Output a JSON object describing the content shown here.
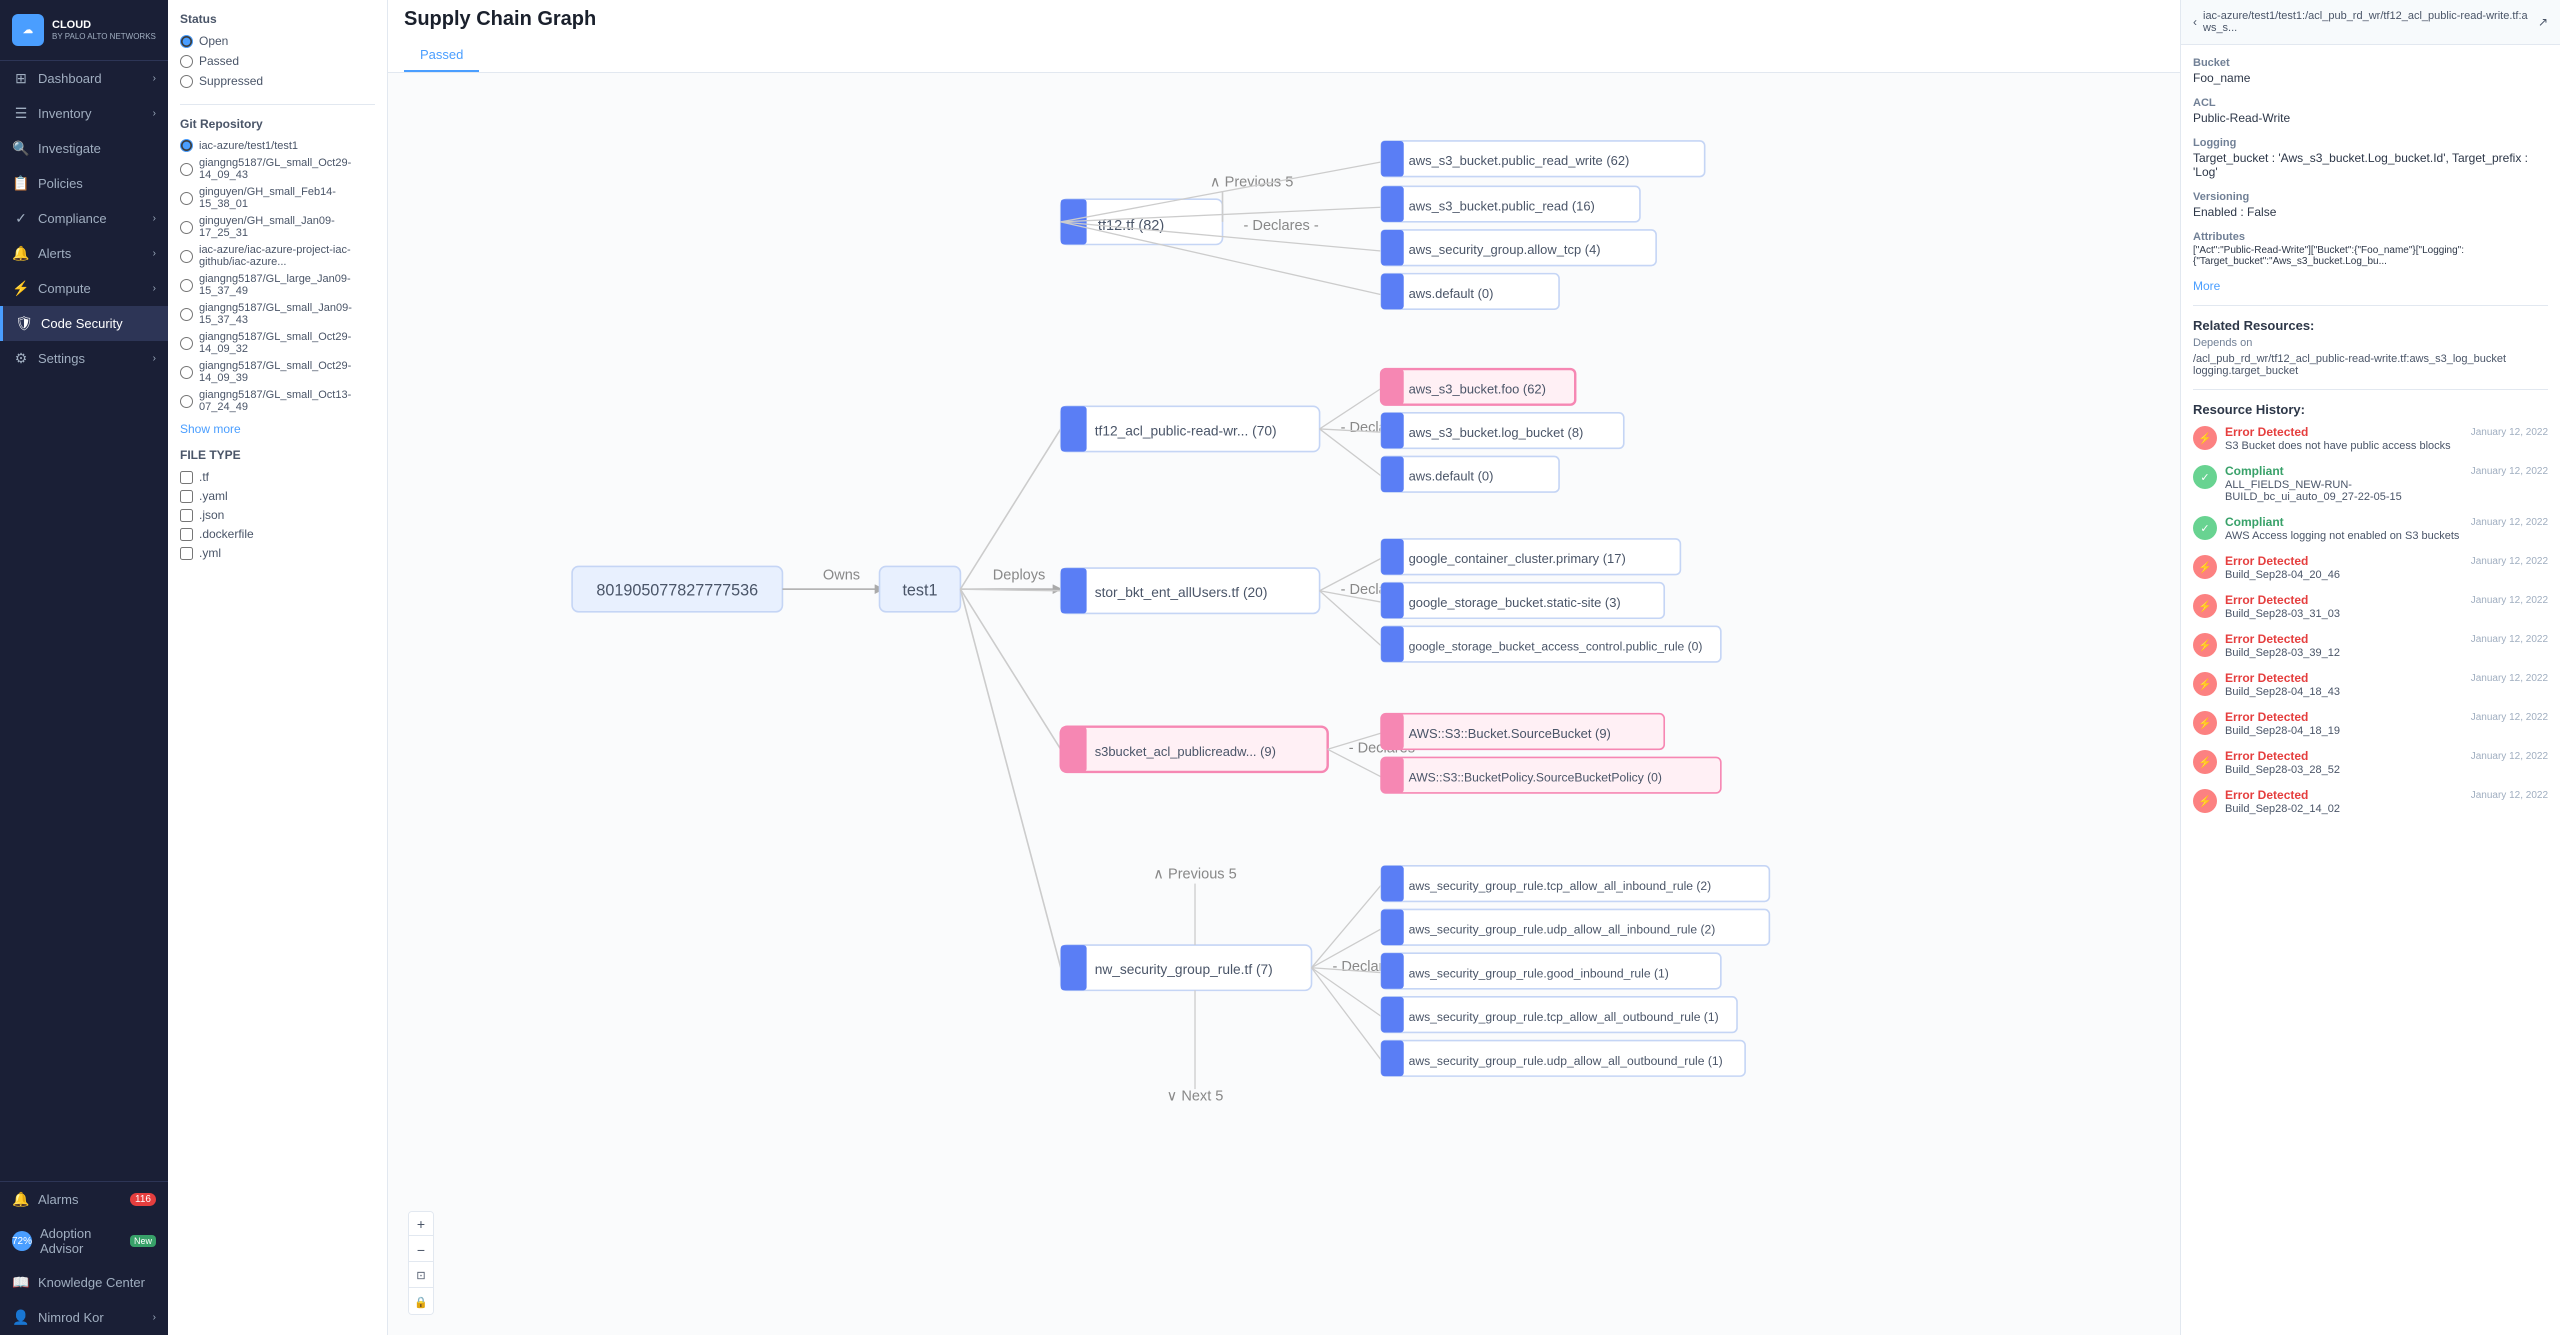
{
  "sidebar": {
    "logo": {
      "line1": "CLOUD",
      "line2": "BY PALO ALTO NETWORKS"
    },
    "items": [
      {
        "id": "dashboard",
        "label": "Dashboard",
        "icon": "⊞",
        "hasChevron": true
      },
      {
        "id": "inventory",
        "label": "Inventory",
        "icon": "☰",
        "hasChevron": true
      },
      {
        "id": "investigate",
        "label": "Investigate",
        "icon": "🔍",
        "hasChevron": false
      },
      {
        "id": "policies",
        "label": "Policies",
        "icon": "📋",
        "hasChevron": false
      },
      {
        "id": "compliance",
        "label": "Compliance",
        "icon": "✓",
        "hasChevron": true
      },
      {
        "id": "alerts",
        "label": "Alerts",
        "icon": "🔔",
        "hasChevron": true
      },
      {
        "id": "compute",
        "label": "Compute",
        "icon": "⚡",
        "hasChevron": true
      },
      {
        "id": "code-security",
        "label": "Code Security",
        "icon": "🛡",
        "hasChevron": false,
        "active": true
      },
      {
        "id": "settings",
        "label": "Settings",
        "icon": "⚙",
        "hasChevron": true
      }
    ],
    "bottom": [
      {
        "id": "alarms",
        "label": "Alarms",
        "icon": "🔔",
        "badge": "116"
      },
      {
        "id": "adoption-advisor",
        "label": "Adoption Advisor",
        "icon": "◎",
        "badgeNew": "New",
        "score": "72%"
      },
      {
        "id": "knowledge-center",
        "label": "Knowledge Center",
        "icon": "📖"
      },
      {
        "id": "nimrod-kor",
        "label": "Nimrod Kor",
        "icon": "👤",
        "hasChevron": true
      }
    ]
  },
  "left_panel": {
    "status_title": "Status",
    "status_options": [
      {
        "id": "open",
        "label": "Open",
        "selected": true
      },
      {
        "id": "passed",
        "label": "Passed",
        "selected": false
      },
      {
        "id": "suppressed",
        "label": "Suppressed",
        "selected": false
      }
    ],
    "git_repo_title": "Git Repository",
    "repos": [
      {
        "id": "iac-azure-test1",
        "label": "iac-azure/test1/test1",
        "selected": true
      },
      {
        "id": "giangng-oct29-14",
        "label": "giangng5187/GL_small_Oct29-14_09_43",
        "selected": false
      },
      {
        "id": "ginguyen-feb14",
        "label": "ginguyen/GH_small_Feb14-15_38_01",
        "selected": false
      },
      {
        "id": "ginguyen-gh-jan09",
        "label": "ginguyen/GH_small_Jan09-17_25_31",
        "selected": false
      },
      {
        "id": "iac-azure-project",
        "label": "iac-azure/iac-azure-project-iac-github/iac-azure...",
        "selected": false
      },
      {
        "id": "giangng-large-jan09",
        "label": "giangng5187/GL_large_Jan09-15_37_49",
        "selected": false
      },
      {
        "id": "giangng-small-jan09-37",
        "label": "giangng5187/GL_small_Jan09-15_37_43",
        "selected": false
      },
      {
        "id": "giangng-small-oct29-32",
        "label": "giangng5187/GL_small_Oct29-14_09_32",
        "selected": false
      },
      {
        "id": "giangng-small-oct29-39",
        "label": "giangng5187/GL_small_Oct29-14_09_39",
        "selected": false
      },
      {
        "id": "giangng-small-oct13",
        "label": "giangng5187/GL_small_Oct13-07_24_49",
        "selected": false
      }
    ],
    "show_more": "Show more",
    "file_type_title": "FILE TYPE",
    "file_types": [
      {
        "id": "tf",
        "label": ".tf",
        "checked": false
      },
      {
        "id": "yaml",
        "label": ".yaml",
        "checked": false
      },
      {
        "id": "json",
        "label": ".json",
        "checked": false
      },
      {
        "id": "dockerfile",
        "label": ".dockerfile",
        "checked": false
      },
      {
        "id": "yml",
        "label": ".yml",
        "checked": false
      }
    ]
  },
  "main": {
    "title": "Supply Chain Graph",
    "tabs": [
      {
        "id": "passed",
        "label": "Passed",
        "active": true
      }
    ]
  },
  "right_panel": {
    "header_path": "iac-azure/test1/test1:/acl_pub_rd_wr/tf12_acl_public-read-write.tf:aws_s...",
    "details": [
      {
        "label": "Bucket",
        "value": "Foo_name"
      },
      {
        "label": "ACL",
        "value": "Public-Read-Write"
      },
      {
        "label": "Logging",
        "value": "Target_bucket : 'Aws_s3_bucket.Log_bucket.Id', Target_prefix : 'Log'"
      },
      {
        "label": "Versioning",
        "value": "Enabled : False"
      },
      {
        "label": "Attributes",
        "value": "[\"Act\":\"Public-Read-Write\"][\"Bucket\":{\"Foo_name\"}[\"Logging\":{\"Target_bucket\":\"Aws_s3_bucket.Log_bu..."
      }
    ],
    "more_label": "More",
    "related_resources_title": "Related Resources:",
    "depends_on_label": "Depends on",
    "depends_on_value": "/acl_pub_rd_wr/tf12_acl_public-read-write.tf:aws_s3_log_bucket\nlogging.target_bucket",
    "resource_history_title": "Resource History:",
    "history_items": [
      {
        "status": "Error Detected",
        "type": "error",
        "desc": "S3 Bucket does not have public access blocks",
        "date": "January 12, 2022"
      },
      {
        "status": "Compliant",
        "type": "compliant",
        "desc": "ALL_FIELDS_NEW-RUN-BUILD_bc_ui_auto_09_27-22-05-15",
        "date": "January 12, 2022"
      },
      {
        "status": "Compliant",
        "type": "compliant",
        "desc": "AWS Access logging not enabled on S3 buckets",
        "date": "January 12, 2022"
      },
      {
        "status": "Error Detected",
        "type": "error",
        "desc": "Build_Sep28-04_20_46",
        "date": "January 12, 2022"
      },
      {
        "status": "Error Detected",
        "type": "error",
        "desc": "Build_Sep28-03_31_03",
        "date": "January 12, 2022"
      },
      {
        "status": "Error Detected",
        "type": "error",
        "desc": "Build_Sep28-03_39_12",
        "date": "January 12, 2022"
      },
      {
        "status": "Error Detected",
        "type": "error",
        "desc": "Build_Sep28-04_18_43",
        "date": "January 12, 2022"
      },
      {
        "status": "Error Detected",
        "type": "error",
        "desc": "Build_Sep28-04_18_19",
        "date": "January 12, 2022"
      },
      {
        "status": "Error Detected",
        "type": "error",
        "desc": "Build_Sep28-03_28_52",
        "date": "January 12, 2022"
      },
      {
        "status": "Error Detected",
        "type": "error",
        "desc": "Build_Sep28-02_14_02",
        "date": "January 12, 2022"
      }
    ]
  },
  "graph": {
    "owner_node": "801905077827777536",
    "owner_label": "Owns",
    "test_node": "test1",
    "deploys_label": "Deploys",
    "nodes": [
      {
        "id": "tf12_tf",
        "label": "tf12.tf",
        "count": "82",
        "declares_label": "Declares",
        "children": [
          {
            "label": "aws_s3_bucket.public_read_write",
            "count": "62",
            "color": "blue"
          },
          {
            "label": "aws_s3_bucket.public_read",
            "count": "16",
            "color": "blue"
          },
          {
            "label": "aws_security_group.allow_tcp",
            "count": "4",
            "color": "blue"
          },
          {
            "label": "aws.default",
            "count": "0",
            "color": "blue"
          }
        ],
        "prev": "Previous 5"
      },
      {
        "id": "tf12_acl_public",
        "label": "tf12_acl_public-read-wr...",
        "count": "70",
        "declares_label": "Declares",
        "children": [
          {
            "label": "aws_s3_bucket.foo",
            "count": "62",
            "color": "pink",
            "highlighted": true
          },
          {
            "label": "aws_s3_bucket.log_bucket",
            "count": "8",
            "color": "blue"
          },
          {
            "label": "aws.default",
            "count": "0",
            "color": "blue"
          }
        ]
      },
      {
        "id": "stor_bkt_ent_allusers",
        "label": "stor_bkt_ent_allUsers.tf",
        "count": "20",
        "declares_label": "Declares",
        "children": [
          {
            "label": "google_container_cluster.primary",
            "count": "17",
            "color": "blue"
          },
          {
            "label": "google_storage_bucket.static-site",
            "count": "3",
            "color": "blue"
          },
          {
            "label": "google_storage_bucket_access_control.public_rule",
            "count": "0",
            "color": "blue"
          }
        ]
      },
      {
        "id": "s3bucket_acl_publicreadw",
        "label": "s3bucket_acl_publicreadw...",
        "count": "9",
        "declares_label": "Declares",
        "color": "pink",
        "children": [
          {
            "label": "AWS::S3::Bucket.SourceBucket",
            "count": "9",
            "color": "pink"
          },
          {
            "label": "AWS::S3::BucketPolicy.SourceBucketPolicy",
            "count": "0",
            "color": "pink"
          }
        ]
      },
      {
        "id": "nw_security_group_rule",
        "label": "nw_security_group_rule.tf",
        "count": "7",
        "declares_label": "Declares",
        "children": [
          {
            "label": "aws_security_group_rule.tcp_allow_all_inbound_rule",
            "count": "2",
            "color": "blue"
          },
          {
            "label": "aws_security_group_rule.udp_allow_all_inbound_rule",
            "count": "2",
            "color": "blue"
          },
          {
            "label": "aws_security_group_rule.good_inbound_rule",
            "count": "1",
            "color": "blue"
          },
          {
            "label": "aws_security_group_rule.tcp_allow_all_outbound_rule",
            "count": "1",
            "color": "blue"
          },
          {
            "label": "aws_security_group_rule.udp_allow_all_outbound_rule",
            "count": "1",
            "color": "blue"
          }
        ],
        "prev": "Previous 5",
        "next": "Next 5"
      }
    ]
  },
  "zoom_controls": {
    "zoom_in": "+",
    "zoom_out": "−",
    "fit": "⊡",
    "lock": "🔒"
  }
}
